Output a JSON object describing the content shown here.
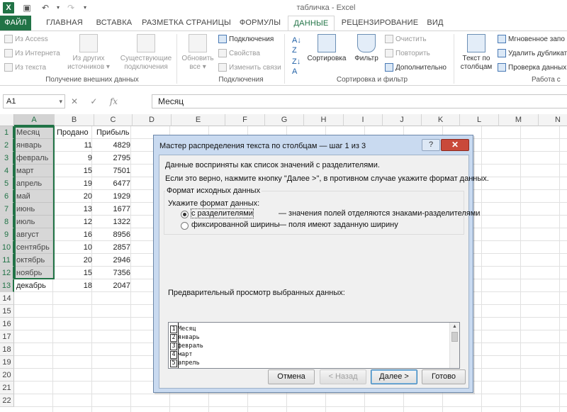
{
  "titlebar": {
    "app_icon": "X",
    "title": "табличка - Excel"
  },
  "tabs": [
    "ФАЙЛ",
    "ГЛАВНАЯ",
    "ВСТАВКА",
    "РАЗМЕТКА СТРАНИЦЫ",
    "ФОРМУЛЫ",
    "ДАННЫЕ",
    "РЕЦЕНЗИРОВАНИЕ",
    "ВИД"
  ],
  "ribbon": {
    "external": {
      "from_access": "Из Access",
      "from_web": "Из Интернета",
      "from_text": "Из текста",
      "other_sources": [
        "Из других",
        "источников ▾"
      ],
      "existing": [
        "Существующие",
        "подключения"
      ],
      "label": "Получение внешних данных"
    },
    "connections": {
      "refresh_all": [
        "Обновить",
        "все ▾"
      ],
      "connections": "Подключения",
      "properties": "Свойства",
      "edit_links": "Изменить связи",
      "label": "Подключения"
    },
    "sort_filter": {
      "sort": "Сортировка",
      "filter": "Фильтр",
      "clear": "Очистить",
      "reapply": "Повторить",
      "advanced": "Дополнительно",
      "label": "Сортировка и фильтр"
    },
    "data_tools": {
      "text_to_columns": [
        "Текст по",
        "столбцам"
      ],
      "flash_fill": "Мгновенное запо",
      "remove_duplicates": "Удалить дубликат",
      "data_validation": "Проверка данных",
      "label": "Работа с"
    }
  },
  "formula_bar": {
    "name_box": "A1",
    "cancel": "✕",
    "enter": "✓",
    "fx": "fx",
    "content": "Месяц"
  },
  "grid": {
    "columns": [
      "A",
      "B",
      "C",
      "D",
      "E",
      "F",
      "G",
      "H",
      "I",
      "J",
      "K",
      "L",
      "M",
      "N"
    ],
    "rows": [
      "1",
      "2",
      "3",
      "4",
      "5",
      "6",
      "7",
      "8",
      "9",
      "10",
      "11",
      "12",
      "13",
      "14",
      "15",
      "16",
      "17",
      "18",
      "19",
      "20",
      "21",
      "22"
    ],
    "data": [
      [
        "Месяц",
        "Продано",
        "Прибыль"
      ],
      [
        "январь",
        "11",
        "4829"
      ],
      [
        "февраль",
        "9",
        "2795"
      ],
      [
        "март",
        "15",
        "7501"
      ],
      [
        "апрель",
        "19",
        "6477"
      ],
      [
        "май",
        "20",
        "1929"
      ],
      [
        "июнь",
        "13",
        "1677"
      ],
      [
        "июль",
        "12",
        "1322"
      ],
      [
        "август",
        "16",
        "8956"
      ],
      [
        "сентябрь",
        "10",
        "2857"
      ],
      [
        "октябрь",
        "20",
        "2946"
      ],
      [
        "ноябрь",
        "15",
        "7356"
      ],
      [
        "декабрь",
        "18",
        "2047"
      ]
    ]
  },
  "dialog": {
    "title": "Мастер распределения текста по столбцам — шаг 1 из 3",
    "help": "?",
    "close": "✕",
    "line1": "Данные восприняты как список значений с разделителями.",
    "line2": "Если это верно, нажмите кнопку \"Далее >\", в противном случае укажите формат данных.",
    "group_title": "Формат исходных данных",
    "prompt": "Укажите формат данных:",
    "opt_delimited": "с разделителями",
    "opt_delimited_desc": "— значения полей отделяются знаками-разделителями",
    "opt_fixed": "фиксированной ширины",
    "opt_fixed_desc": "— поля имеют заданную ширину",
    "preview_label": "Предварительный просмотр выбранных данных:",
    "preview_rows": [
      {
        "n": "1",
        "text": "Месяц"
      },
      {
        "n": "2",
        "text": "январь"
      },
      {
        "n": "3",
        "text": "февраль"
      },
      {
        "n": "4",
        "text": "март"
      },
      {
        "n": "5",
        "text": "апрель"
      }
    ],
    "btn_cancel": "Отмена",
    "btn_back": "< Назад",
    "btn_next": "Далее >",
    "btn_finish": "Готово"
  }
}
